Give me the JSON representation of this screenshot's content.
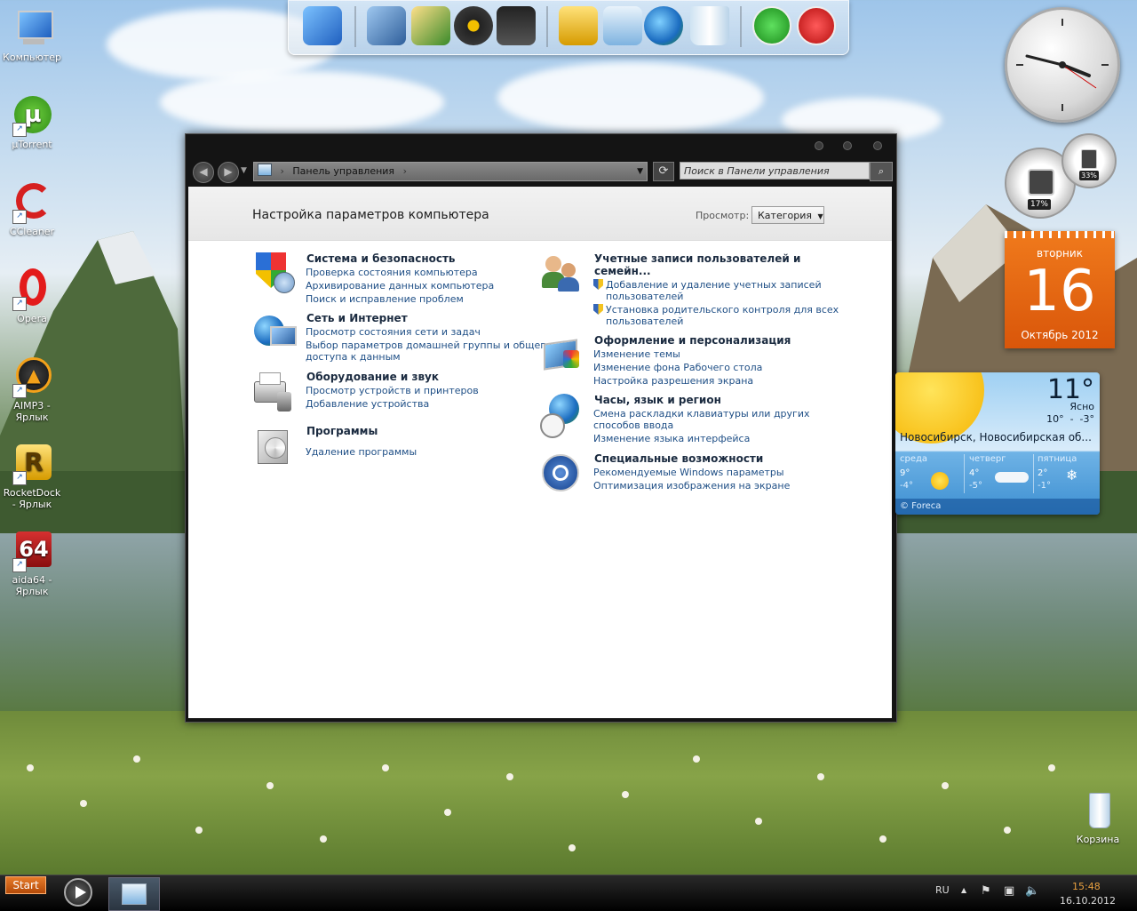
{
  "desktop": {
    "icons": [
      {
        "label": "Компьютер",
        "shortcut": false
      },
      {
        "label": "µTorrent",
        "shortcut": true
      },
      {
        "label": "CCleaner",
        "shortcut": true
      },
      {
        "label": "Opera",
        "shortcut": true
      },
      {
        "label": "AIMP3 - Ярлык",
        "shortcut": true
      },
      {
        "label": "RocketDock - Ярлык",
        "shortcut": true
      },
      {
        "label": "aida64 - Ярлык",
        "shortcut": true
      }
    ],
    "recycle_bin": "Корзина"
  },
  "window": {
    "address": "Панель управления",
    "search_placeholder": "Поиск в Панели управления",
    "header_title": "Настройка параметров компьютера",
    "view_label": "Просмотр:",
    "view_value": "Категория",
    "categories": [
      {
        "title": "Система и безопасность",
        "links": [
          "Проверка состояния компьютера",
          "Архивирование данных компьютера",
          "Поиск и исправление проблем"
        ]
      },
      {
        "title": "Сеть и Интернет",
        "links": [
          "Просмотр состояния сети и задач",
          "Выбор параметров домашней группы и общего",
          "доступа к данным"
        ]
      },
      {
        "title": "Оборудование и звук",
        "links": [
          "Просмотр устройств и принтеров",
          "Добавление устройства"
        ]
      },
      {
        "title": "Программы",
        "links": [
          "Удаление программы"
        ]
      },
      {
        "title": "Учетные записи пользователей и",
        "title2": "семейн...",
        "links": [
          "Добавление и удаление учетных записей",
          "пользователей",
          "Установка родительского контроля для всех",
          "пользователей"
        ]
      },
      {
        "title": "Оформление и персонализация",
        "links": [
          "Изменение темы",
          "Изменение фона Рабочего стола",
          "Настройка разрешения экрана"
        ]
      },
      {
        "title": "Часы, язык и регион",
        "links": [
          "Смена раскладки клавиатуры или других",
          "способов ввода",
          "Изменение языка интерфейса"
        ]
      },
      {
        "title": "Специальные возможности",
        "links": [
          "Рекомендуемые Windows параметры",
          "Оптимизация изображения на экране"
        ]
      }
    ]
  },
  "gadgets": {
    "cpu_percent": "17%",
    "ram_percent": "33%",
    "calendar": {
      "weekday": "вторник",
      "day": "16",
      "month_year": "Октябрь 2012"
    },
    "weather": {
      "temp": "11°",
      "condition": "Ясно",
      "range": "10°  -  -3°",
      "location": "Новосибирск, Новосибирская об...",
      "forecast": [
        {
          "day": "среда",
          "high": "9°",
          "low": "-4°"
        },
        {
          "day": "четверг",
          "high": "4°",
          "low": "-5°"
        },
        {
          "day": "пятница",
          "high": "2°",
          "low": "-1°"
        }
      ],
      "source": "© Foreca"
    }
  },
  "taskbar": {
    "start_label": "Start",
    "language": "RU",
    "time": "15:48",
    "date": "16.10.2012"
  },
  "colors": {
    "accent": "#e0701a",
    "link": "#1f4f86",
    "window_frame": "#141414"
  }
}
